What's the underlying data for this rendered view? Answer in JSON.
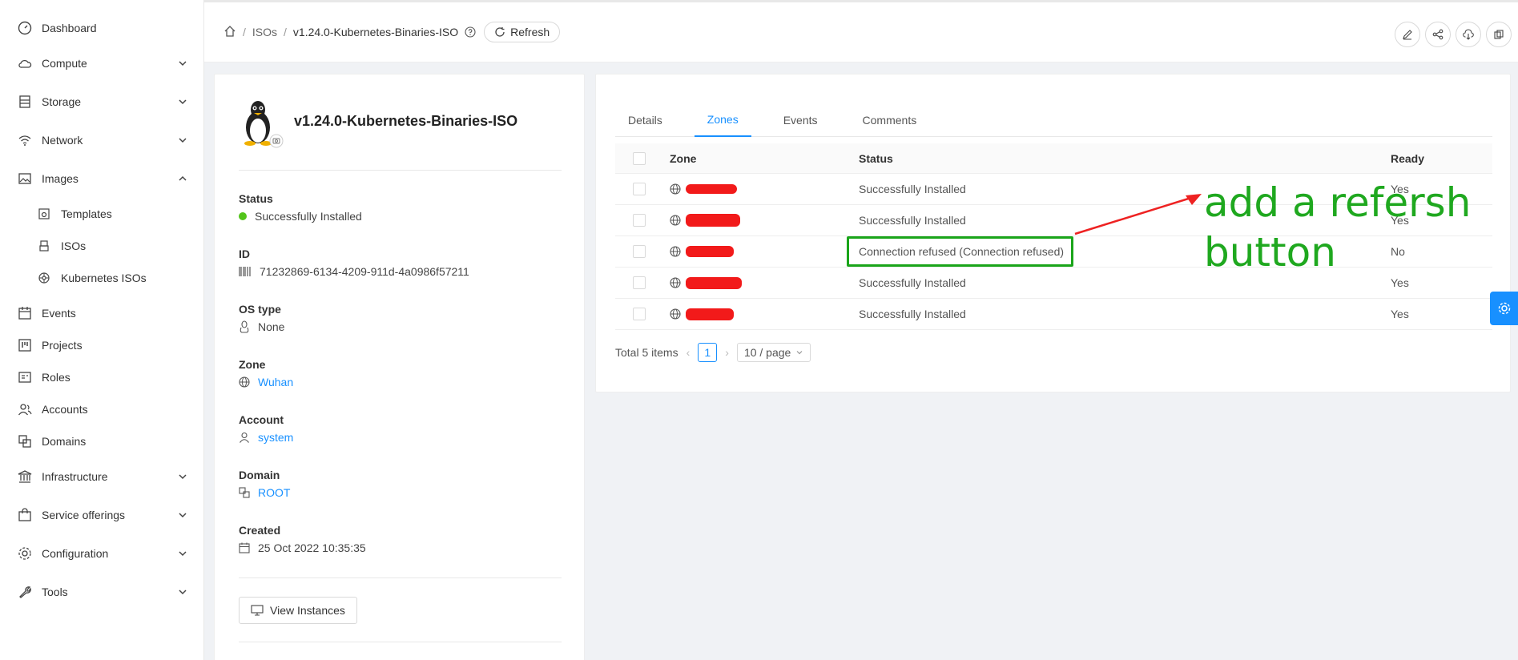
{
  "sidebar": {
    "items": [
      {
        "label": "Dashboard"
      },
      {
        "label": "Compute"
      },
      {
        "label": "Storage"
      },
      {
        "label": "Network"
      },
      {
        "label": "Images"
      },
      {
        "label": "Templates"
      },
      {
        "label": "ISOs"
      },
      {
        "label": "Kubernetes ISOs"
      },
      {
        "label": "Events"
      },
      {
        "label": "Projects"
      },
      {
        "label": "Roles"
      },
      {
        "label": "Accounts"
      },
      {
        "label": "Domains"
      },
      {
        "label": "Infrastructure"
      },
      {
        "label": "Service offerings"
      },
      {
        "label": "Configuration"
      },
      {
        "label": "Tools"
      }
    ]
  },
  "header": {
    "breadcrumb": {
      "sep": "/",
      "parent": "ISOs",
      "current": "v1.24.0-Kubernetes-Binaries-ISO"
    },
    "refresh_label": "Refresh"
  },
  "resource": {
    "title": "v1.24.0-Kubernetes-Binaries-ISO",
    "fields": {
      "status_label": "Status",
      "status_value": "Successfully Installed",
      "id_label": "ID",
      "id_value": "71232869-6134-4209-911d-4a0986f57211",
      "ostype_label": "OS type",
      "ostype_value": "None",
      "zone_label": "Zone",
      "zone_value": "Wuhan",
      "account_label": "Account",
      "account_value": "system",
      "domain_label": "Domain",
      "domain_value": "ROOT",
      "created_label": "Created",
      "created_value": "25 Oct 2022 10:35:35"
    },
    "view_instances_label": "View Instances"
  },
  "tabs": {
    "details": "Details",
    "zones": "Zones",
    "events": "Events",
    "comments": "Comments"
  },
  "table": {
    "headers": {
      "zone": "Zone",
      "status": "Status",
      "ready": "Ready"
    },
    "rows": [
      {
        "status": "Successfully Installed",
        "ready": "Yes"
      },
      {
        "status": "Successfully Installed",
        "ready": "Yes"
      },
      {
        "status": "Connection refused (Connection refused)",
        "ready": "No"
      },
      {
        "status": "Successfully Installed",
        "ready": "Yes"
      },
      {
        "status": "Successfully Installed",
        "ready": "Yes"
      }
    ]
  },
  "pagination": {
    "total": "Total 5 items",
    "page": "1",
    "page_size": "10 / page"
  },
  "annotation": {
    "line1": "add a refersh",
    "line2": "button",
    "color": "#1fa81f"
  },
  "colors": {
    "accent": "#1890ff",
    "success": "#52c41a",
    "redaction": "#f21a1a"
  }
}
